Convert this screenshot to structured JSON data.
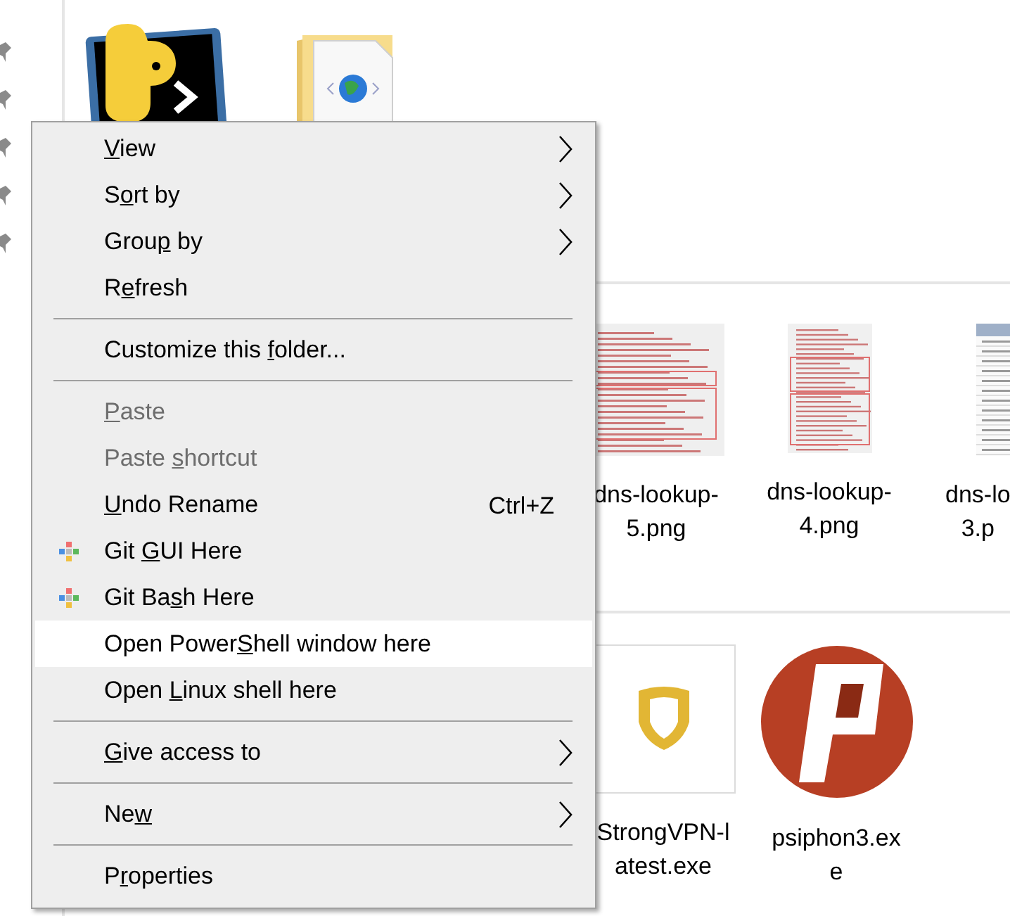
{
  "groups": [
    {
      "files": [
        {
          "kind": "python-terminal"
        },
        {
          "kind": "web-folder"
        }
      ]
    },
    {
      "files": [
        {
          "kind": "text-thumbnail",
          "label_lines": [
            "dns-lookup-",
            "5.png"
          ]
        },
        {
          "kind": "tall-thumbnail",
          "label_lines": [
            "dns-lookup-",
            "4.png"
          ]
        },
        {
          "kind": "table-thumbnail",
          "label_lines": [
            "dns-lo",
            "3.p"
          ]
        }
      ]
    },
    {
      "files": [
        {
          "kind": "shield-app",
          "label_lines": [
            "StrongVPN-l",
            "atest.exe"
          ]
        },
        {
          "kind": "round-app",
          "label_lines": [
            "psiphon3.ex",
            "e"
          ]
        }
      ]
    }
  ],
  "context_menu": {
    "items": [
      {
        "kind": "item",
        "key": "V",
        "post": "iew",
        "submenu": true,
        "disabled": false,
        "selected": false
      },
      {
        "kind": "item",
        "pre": "S",
        "key": "o",
        "post": "rt by",
        "submenu": true,
        "disabled": false,
        "selected": false
      },
      {
        "kind": "item",
        "pre": "Grou",
        "key": "p",
        "post": " by",
        "submenu": true,
        "disabled": false,
        "selected": false
      },
      {
        "kind": "item",
        "pre": "R",
        "key": "e",
        "post": "fresh",
        "submenu": false,
        "disabled": false,
        "selected": false
      },
      {
        "kind": "separator"
      },
      {
        "kind": "item",
        "pre": "Customize this ",
        "key": "f",
        "post": "older...",
        "submenu": false,
        "disabled": false,
        "selected": false
      },
      {
        "kind": "separator"
      },
      {
        "kind": "item",
        "key": "P",
        "post": "aste",
        "submenu": false,
        "disabled": true,
        "selected": false
      },
      {
        "kind": "item",
        "pre": "Paste ",
        "key": "s",
        "post": "hortcut",
        "submenu": false,
        "disabled": true,
        "selected": false
      },
      {
        "kind": "item",
        "key": "U",
        "post": "ndo Rename",
        "shortcut": "Ctrl+Z",
        "submenu": false,
        "disabled": false,
        "selected": false
      },
      {
        "kind": "item",
        "pre": "Git ",
        "key": "G",
        "post": "UI Here",
        "icon": true,
        "submenu": false,
        "disabled": false,
        "selected": false
      },
      {
        "kind": "item",
        "pre": "Git Ba",
        "key": "s",
        "post": "h Here",
        "icon": true,
        "submenu": false,
        "disabled": false,
        "selected": false
      },
      {
        "kind": "item",
        "pre": "Open Power",
        "key": "S",
        "post": "hell window here",
        "submenu": false,
        "disabled": false,
        "selected": true
      },
      {
        "kind": "item",
        "pre": "Open ",
        "key": "L",
        "post": "inux shell here",
        "submenu": false,
        "disabled": false,
        "selected": false
      },
      {
        "kind": "separator"
      },
      {
        "kind": "item",
        "key": "G",
        "post": "ive access to",
        "submenu": true,
        "disabled": false,
        "selected": false
      },
      {
        "kind": "separator"
      },
      {
        "kind": "item",
        "pre": "Ne",
        "key": "w",
        "submenu": true,
        "disabled": false,
        "selected": false
      },
      {
        "kind": "separator"
      },
      {
        "kind": "item",
        "pre": "P",
        "key": "r",
        "post": "operties",
        "submenu": false,
        "disabled": false,
        "selected": false
      }
    ]
  }
}
